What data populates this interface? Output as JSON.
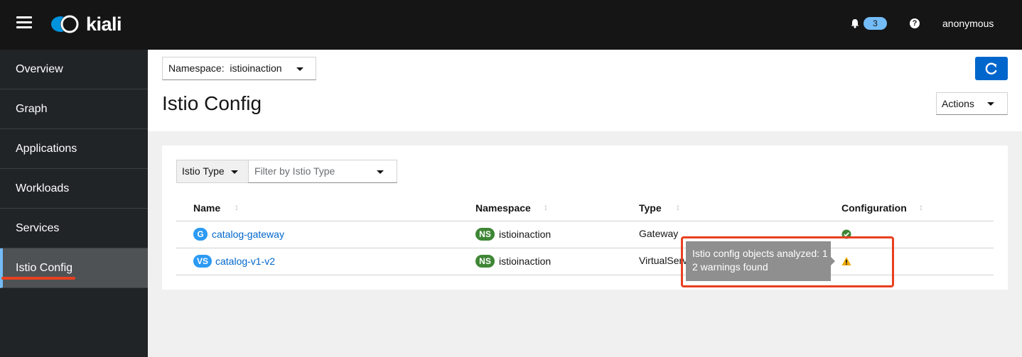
{
  "header": {
    "logo_text": "kiali",
    "notification_count": "3",
    "help_symbol": "?",
    "user": "anonymous"
  },
  "sidebar": {
    "items": [
      {
        "label": "Overview"
      },
      {
        "label": "Graph"
      },
      {
        "label": "Applications"
      },
      {
        "label": "Workloads"
      },
      {
        "label": "Services"
      },
      {
        "label": "Istio Config",
        "active": true
      }
    ]
  },
  "toolbar": {
    "namespace_label": "Namespace:",
    "namespace_value": "istioinaction",
    "page_title": "Istio Config",
    "actions_label": "Actions"
  },
  "filter": {
    "type_label": "Istio Type",
    "placeholder": "Filter by Istio Type"
  },
  "table": {
    "columns": [
      "Name",
      "Namespace",
      "Type",
      "Configuration"
    ],
    "rows": [
      {
        "badge": "G",
        "name": "catalog-gateway",
        "ns_badge": "NS",
        "namespace": "istioinaction",
        "type": "Gateway",
        "config": "ok"
      },
      {
        "badge": "VS",
        "name": "catalog-v1-v2",
        "ns_badge": "NS",
        "namespace": "istioinaction",
        "type": "VirtualService",
        "config": "warning"
      }
    ]
  },
  "tooltip": {
    "line1": "Istio config objects analyzed: 1",
    "line2": "2 warnings found"
  },
  "colors": {
    "accent": "#0066cc",
    "ok": "#3e8635",
    "warning": "#f0ab00",
    "highlight": "#e8401f"
  }
}
